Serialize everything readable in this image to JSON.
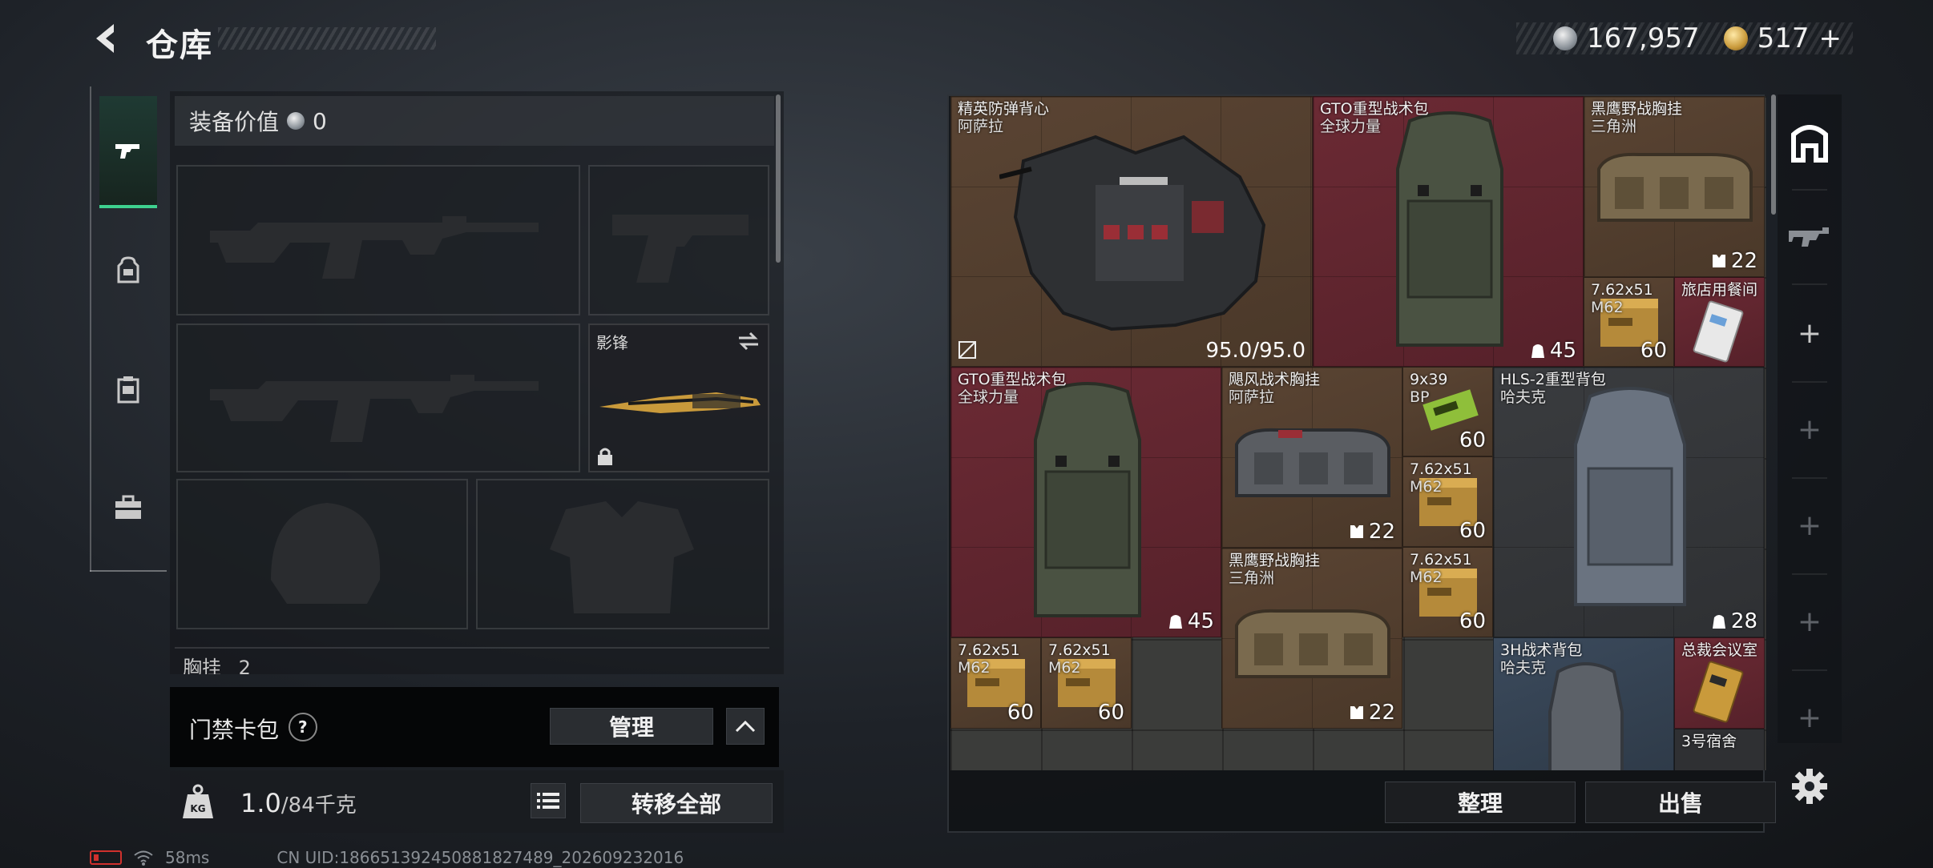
{
  "header": {
    "title": "仓库",
    "currency_silver": "167,957",
    "currency_gold": "517",
    "currency_gold_suffix": "+"
  },
  "loadout": {
    "equip_value_label": "装备价值",
    "equip_value": "0",
    "melee_label": "影锋",
    "chest_label": "胸挂",
    "chest_count": "2",
    "keycard_label": "门禁卡包",
    "keycard_help": "?",
    "manage_label": "管理",
    "weight_value": "1.0",
    "weight_max": "/84千克",
    "transfer_all_label": "转移全部"
  },
  "status": {
    "ping": "58ms",
    "uid": "CN UID:18665139245088182748​9_202609232016"
  },
  "stash": {
    "items": [
      {
        "name": "精英防弹背心",
        "sub": "阿萨拉",
        "qty": "95.0/95.0"
      },
      {
        "name": "GTO重型战术包",
        "sub": "全球力量",
        "qty": "45"
      },
      {
        "name": "黑鹰野战胸挂",
        "sub": "三角洲",
        "qty": "22"
      },
      {
        "name": "7.62x51",
        "sub": "M62",
        "qty": "60"
      },
      {
        "name": "旅店用餐间",
        "sub": "",
        "qty": ""
      },
      {
        "name": "GTO重型战术包",
        "sub": "全球力量",
        "qty": "45"
      },
      {
        "name": "飓风战术胸挂",
        "sub": "阿萨拉",
        "qty": "22"
      },
      {
        "name": "9x39",
        "sub": "BP",
        "qty": "60"
      },
      {
        "name": "HLS-2重型背包",
        "sub": "哈夫克",
        "qty": "28"
      },
      {
        "name": "7.62x51",
        "sub": "M62",
        "qty": "60"
      },
      {
        "name": "黑鹰野战胸挂",
        "sub": "三角洲",
        "qty": "22"
      },
      {
        "name": "7.62x51",
        "sub": "M62",
        "qty": "60"
      },
      {
        "name": "7.62x51",
        "sub": "M62",
        "qty": "60"
      },
      {
        "name": "7.62x51",
        "sub": "M62",
        "qty": "60"
      },
      {
        "name": "3H战术背包",
        "sub": "哈夫克",
        "qty": ""
      },
      {
        "name": "总裁会议室",
        "sub": "",
        "qty": ""
      },
      {
        "name": "3号宿舍",
        "sub": "",
        "qty": ""
      }
    ],
    "sort_label": "整理",
    "sell_label": "出售"
  },
  "colors": {
    "accent_green": "#3ed18f",
    "rarity_red": "#6b2a34",
    "rarity_brown": "#5a4433",
    "rarity_blue": "#3b4a5c"
  }
}
